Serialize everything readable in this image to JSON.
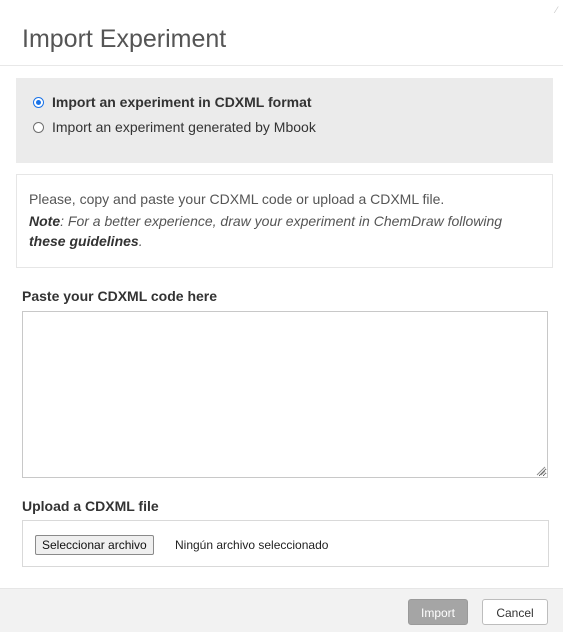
{
  "dialog": {
    "title": "Import Experiment"
  },
  "format_options": [
    {
      "label": "Import an experiment in CDXML format",
      "selected": true
    },
    {
      "label": "Import an experiment generated by Mbook",
      "selected": false
    }
  ],
  "info": {
    "text": "Please, copy and paste your CDXML code or upload a CDXML file.",
    "note_label": "Note",
    "note_text": ": For a better experience, draw your experiment in ChemDraw following ",
    "note_link": "these guidelines",
    "note_end": "."
  },
  "paste": {
    "label": "Paste your CDXML code here",
    "value": ""
  },
  "upload": {
    "label": "Upload a CDXML file",
    "button_label": "Seleccionar archivo",
    "status": "Ningún archivo seleccionado"
  },
  "footer": {
    "import_label": "Import",
    "cancel_label": "Cancel"
  },
  "colors": {
    "radio_accent": "#1a73e8",
    "import_button_bg": "#a5a5a5",
    "format_panel_bg": "#ebebeb"
  },
  "icons": {
    "radio_selected": "radio-checked-icon",
    "radio_unselected": "radio-unchecked-icon",
    "resize": "resize-grip-icon"
  }
}
